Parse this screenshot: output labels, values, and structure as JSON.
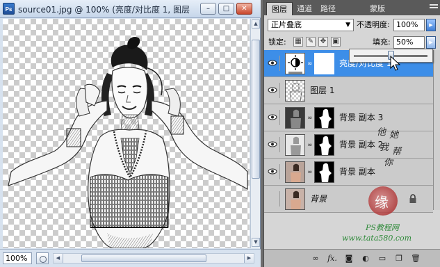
{
  "document": {
    "title": "source01.jpg @ 100% (亮度/对比度 1, 图层",
    "zoom": "100%",
    "app_icon": "Ps"
  },
  "window_buttons": {
    "minimize": "–",
    "restore": "□",
    "close": "✕"
  },
  "panel": {
    "tabs": [
      {
        "label": "图层",
        "active": true
      },
      {
        "label": "通道",
        "active": false
      },
      {
        "label": "路径",
        "active": false
      },
      {
        "label": "蒙版",
        "active": false
      }
    ],
    "blend_mode": "正片叠底",
    "opacity_label": "不透明度:",
    "opacity_value": "100%",
    "lock_label": "锁定:",
    "fill_label": "填充:",
    "fill_value": "50%",
    "fill_slider_fraction": 0.5
  },
  "layers": [
    {
      "name": "亮度/对比度 1",
      "type": "adjustment",
      "visible": true,
      "selected": true
    },
    {
      "name": "图层 1",
      "type": "pixel",
      "visible": true,
      "selected": false
    },
    {
      "name": "背景 副本 3",
      "type": "masked",
      "visible": true,
      "selected": false
    },
    {
      "name": "背景 副本 2",
      "type": "masked",
      "visible": true,
      "selected": false
    },
    {
      "name": "背景 副本",
      "type": "masked",
      "visible": true,
      "selected": false
    },
    {
      "name": "背景",
      "type": "background",
      "visible": false,
      "selected": false,
      "locked": true
    }
  ],
  "watermark": {
    "calligraphy": [
      "他",
      "她",
      "我",
      "帮",
      "你"
    ],
    "seal_char": "缘",
    "site_line1": "PS教程网",
    "site_line2": "www.tata580.com"
  },
  "bottom_icons": [
    "link-icon",
    "fx-icon",
    "mask-icon",
    "adjustment-icon",
    "folder-icon",
    "new-layer-icon",
    "trash-icon"
  ],
  "bottom_labels": {
    "fx": "fx."
  },
  "colors": {
    "selection": "#3d8ee8",
    "panel_bg": "#d6d6d6",
    "tab_bar": "#5a5a5a",
    "credit_green": "#2f8a3a"
  }
}
